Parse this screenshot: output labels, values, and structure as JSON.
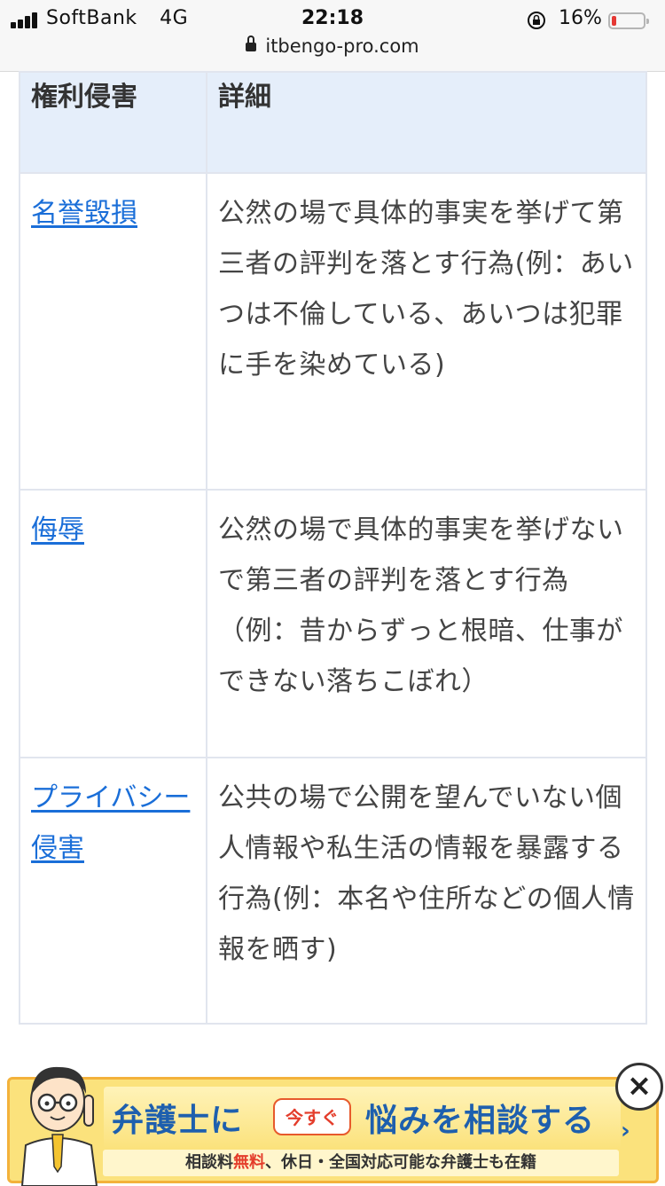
{
  "status_bar": {
    "carrier": "SoftBank",
    "network": "4G",
    "time": "22:18",
    "battery_percent": "16%",
    "battery_level": 0.16,
    "battery_color": "#e53935"
  },
  "url_bar": {
    "domain": "itbengo-pro.com",
    "icon": "padlock-icon"
  },
  "table": {
    "headers": [
      "権利侵害",
      "詳細"
    ],
    "rows": [
      {
        "term": "名誉毀損",
        "detail": "公然の場で具体的事実を挙げて第三者の評判を落とす行為(例：あいつは不倫している、あいつは犯罪に手を染めている)"
      },
      {
        "term": "侮辱",
        "detail": "公然の場で具体的事実を挙げないで第三者の評判を落とす行為（例：昔からずっと根暗、仕事ができない落ちこぼれ）"
      },
      {
        "term": "プライバシー侵害",
        "detail": "公共の場で公開を望んでいない個人情報や私生活の情報を暴露する行為(例：本名や住所などの個人情報を晒す)"
      }
    ],
    "link_color": "#1a6ed8",
    "header_bg": "#e5eefa"
  },
  "ad": {
    "headline_left": "弁護士に",
    "pill": "今すぐ",
    "headline_right": "悩みを相談する",
    "sub_pre": "相談料",
    "sub_red": "無料",
    "sub_post": "、休日・全国対応可能な弁護士も在籍",
    "close_label": "×"
  }
}
